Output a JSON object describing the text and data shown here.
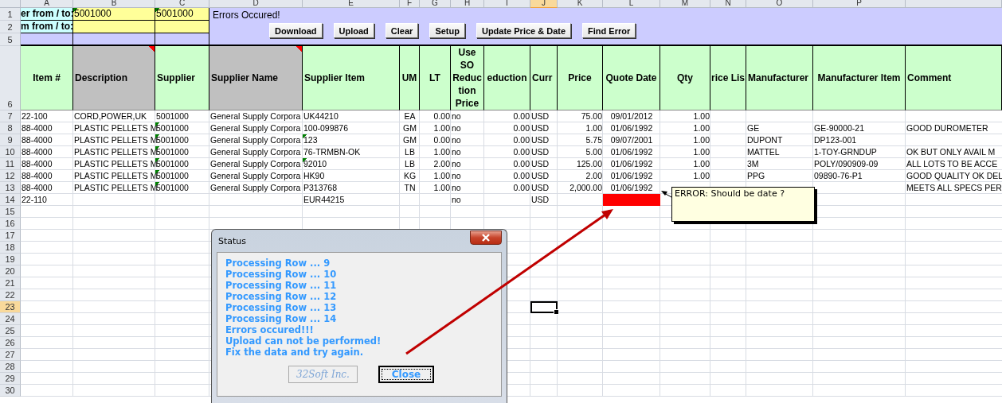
{
  "column_letters": [
    {
      "label": "A",
      "selected": false
    },
    {
      "label": "B",
      "selected": false
    },
    {
      "label": "C",
      "selected": false
    },
    {
      "label": "D",
      "selected": false
    },
    {
      "label": "E",
      "selected": false
    },
    {
      "label": "F",
      "selected": false
    },
    {
      "label": "G",
      "selected": false
    },
    {
      "label": "H",
      "selected": false
    },
    {
      "label": "I",
      "selected": false
    },
    {
      "label": "J",
      "selected": true
    },
    {
      "label": "K",
      "selected": false
    },
    {
      "label": "L",
      "selected": false
    },
    {
      "label": "M",
      "selected": false
    },
    {
      "label": "N",
      "selected": false
    },
    {
      "label": "O",
      "selected": false
    },
    {
      "label": "P",
      "selected": false
    }
  ],
  "filter_rows": [
    {
      "row": "1",
      "label": "er from / to:",
      "from": "5001000",
      "to": "5001000",
      "flagged": true
    },
    {
      "row": "2",
      "label": "m from / to:",
      "flagged": false
    }
  ],
  "spacer_row": "5",
  "toolbar": {
    "message": "Errors Occured!",
    "buttons": [
      "Download",
      "Upload",
      "Clear",
      "Setup",
      "Update Price & Date",
      "Find Error"
    ]
  },
  "header_row": "6",
  "columns": [
    {
      "label": "Item #",
      "shaded": false,
      "comment": false
    },
    {
      "label": "Description",
      "shaded": true,
      "comment": true
    },
    {
      "label": "Supplier",
      "shaded": false,
      "comment": false
    },
    {
      "label": "Supplier Name",
      "shaded": true,
      "comment": true
    },
    {
      "label": "Supplier Item",
      "shaded": false,
      "comment": false
    },
    {
      "label": "UM",
      "shaded": false,
      "comment": false
    },
    {
      "label": "LT",
      "shaded": false,
      "comment": false
    },
    {
      "label": "Use SO Reduc tion Price",
      "shaded": false,
      "comment": false
    },
    {
      "label": "eduction",
      "shaded": false,
      "comment": false
    },
    {
      "label": "Curr",
      "shaded": false,
      "comment": false
    },
    {
      "label": "Price",
      "shaded": false,
      "comment": false
    },
    {
      "label": "Quote Date",
      "shaded": false,
      "comment": false
    },
    {
      "label": "Qty",
      "shaded": false,
      "comment": false
    },
    {
      "label": "rice Lis",
      "shaded": false,
      "comment": false
    },
    {
      "label": "Manufacturer",
      "shaded": false,
      "comment": false
    },
    {
      "label": "Manufacturer Item",
      "shaded": false,
      "comment": false
    },
    {
      "label": "Comment",
      "shaded": false,
      "comment": false
    }
  ],
  "rows": [
    {
      "row": "7",
      "supplier_flag": false,
      "item_flag": false,
      "date_error": false,
      "cells": [
        "22-100",
        "CORD,POWER,UK",
        "5001000",
        "General Supply Corpora",
        "UK44210",
        "EA",
        "0.00",
        "no",
        "0.00",
        "USD",
        "75.00",
        "09/01/2012",
        "1.00",
        null,
        null,
        null,
        null
      ]
    },
    {
      "row": "8",
      "supplier_flag": true,
      "item_flag": false,
      "date_error": false,
      "cells": [
        "88-4000",
        "PLASTIC PELLETS M",
        "5001000",
        "General Supply Corpora",
        "100-099876",
        "GM",
        "1.00",
        "no",
        "0.00",
        "USD",
        "1.00",
        "01/06/1992",
        "1.00",
        null,
        "GE",
        "GE-90000-21",
        "GOOD DUROMETER"
      ]
    },
    {
      "row": "9",
      "supplier_flag": true,
      "item_flag": true,
      "date_error": false,
      "cells": [
        "88-4000",
        "PLASTIC PELLETS M",
        "5001000",
        "General Supply Corpora",
        "123",
        "GM",
        "0.00",
        "no",
        "0.00",
        "USD",
        "5.75",
        "09/07/2001",
        "1.00",
        null,
        "DUPONT",
        "DP123-001",
        null
      ]
    },
    {
      "row": "10",
      "supplier_flag": true,
      "item_flag": false,
      "date_error": false,
      "cells": [
        "88-4000",
        "PLASTIC PELLETS M",
        "5001000",
        "General Supply Corpora",
        "76-TRMBN-OK",
        "LB",
        "1.00",
        "no",
        "0.00",
        "USD",
        "5.00",
        "01/06/1992",
        "1.00",
        null,
        "MATTEL",
        "1-TOY-GRNDUP",
        "OK BUT ONLY AVAIL M"
      ]
    },
    {
      "row": "11",
      "supplier_flag": true,
      "item_flag": true,
      "date_error": false,
      "cells": [
        "88-4000",
        "PLASTIC PELLETS M",
        "5001000",
        "General Supply Corpora",
        "92010",
        "LB",
        "2.00",
        "no",
        "0.00",
        "USD",
        "125.00",
        "01/06/1992",
        "1.00",
        null,
        "3M",
        "POLY/090909-09",
        "ALL LOTS TO BE ACCE"
      ]
    },
    {
      "row": "12",
      "supplier_flag": true,
      "item_flag": false,
      "date_error": false,
      "cells": [
        "88-4000",
        "PLASTIC PELLETS M",
        "5001000",
        "General Supply Corpora",
        "HK90",
        "KG",
        "1.00",
        "no",
        "0.00",
        "USD",
        "2.00",
        "01/06/1992",
        "1.00",
        null,
        "PPG",
        "09890-76-P1",
        "GOOD QUALITY OK DEL"
      ]
    },
    {
      "row": "13",
      "supplier_flag": true,
      "item_flag": false,
      "date_error": false,
      "cells": [
        "88-4000",
        "PLASTIC PELLETS M",
        "5001000",
        "General Supply Corpora",
        "P313768",
        "TN",
        "1.00",
        "no",
        "0.00",
        "USD",
        "2,000.00",
        "01/06/1992",
        null,
        null,
        null,
        null,
        "MEETS ALL SPECS PER"
      ]
    },
    {
      "row": "14",
      "supplier_flag": false,
      "item_flag": false,
      "date_error": true,
      "cells": [
        "22-110",
        null,
        null,
        null,
        "EUR44215",
        null,
        null,
        "no",
        null,
        "USD",
        null,
        null,
        null,
        null,
        null,
        null,
        null
      ]
    }
  ],
  "empty_rows": [
    {
      "row": "15",
      "selected": false
    },
    {
      "row": "16",
      "selected": false
    },
    {
      "row": "17",
      "selected": false
    },
    {
      "row": "18",
      "selected": false
    },
    {
      "row": "19",
      "selected": false
    },
    {
      "row": "20",
      "selected": false
    },
    {
      "row": "21",
      "selected": false
    },
    {
      "row": "22",
      "selected": false
    },
    {
      "row": "23",
      "selected": true
    },
    {
      "row": "24",
      "selected": false
    },
    {
      "row": "25",
      "selected": false
    },
    {
      "row": "26",
      "selected": false
    },
    {
      "row": "27",
      "selected": false
    },
    {
      "row": "28",
      "selected": false
    },
    {
      "row": "29",
      "selected": false
    },
    {
      "row": "30",
      "selected": false
    }
  ],
  "comment": {
    "text": "ERROR: Should be date ?"
  },
  "dialog": {
    "title": "Status",
    "lines": [
      "Processing Row ... 9",
      "Processing Row ... 10",
      "Processing Row ... 11",
      "Processing Row ... 12",
      "Processing Row ... 13",
      "Processing Row ... 14",
      "Errors occured!!!",
      "Upload can not be performed!",
      "Fix the data and try again."
    ],
    "buttons": [
      {
        "label": "32Soft Inc.",
        "disabled": true,
        "focused": false
      },
      {
        "label": "Close",
        "disabled": false,
        "focused": true
      }
    ]
  }
}
